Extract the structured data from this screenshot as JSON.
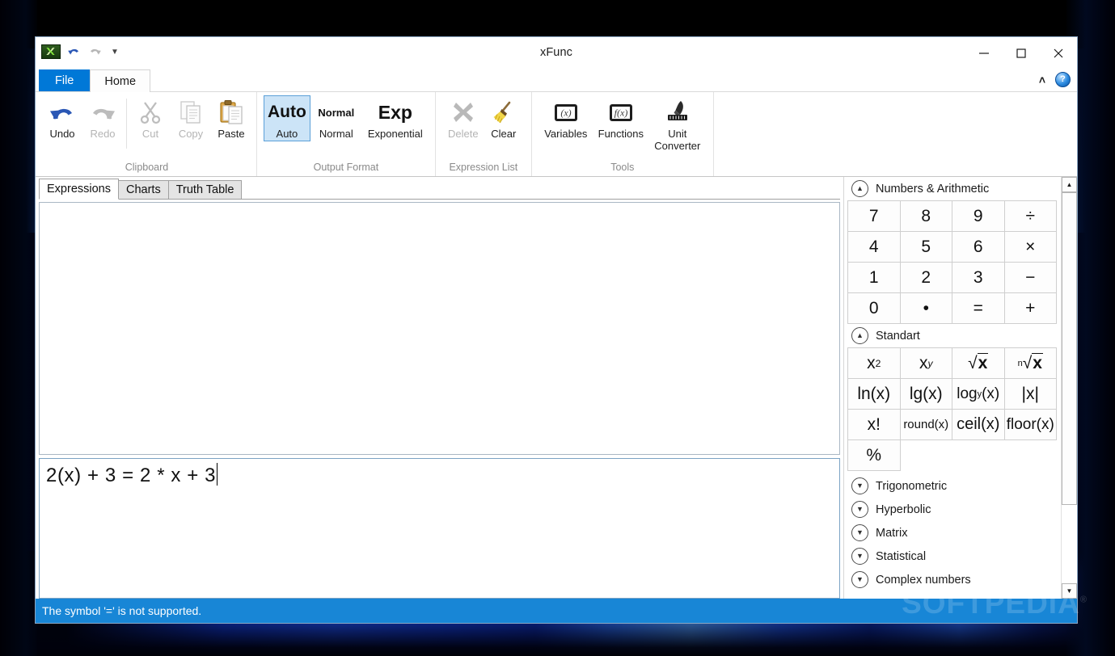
{
  "window": {
    "title": "xFunc",
    "minimize": "─",
    "maximize": "☐",
    "close": "✕"
  },
  "quick_access": {
    "app_icon": "xfunc-app-icon",
    "undo": "undo-arrow-icon",
    "redo": "redo-arrow-icon",
    "customize": "▼"
  },
  "ribbon": {
    "tabs": [
      {
        "label": "File",
        "kind": "file"
      },
      {
        "label": "Home",
        "kind": "active"
      }
    ],
    "collapse": "˄",
    "help": "?",
    "groups": [
      {
        "name": "Clipboard",
        "label": "Clipboard",
        "items": [
          {
            "label": "Undo",
            "icon": "undo-arrow-icon",
            "disabled": false
          },
          {
            "label": "Redo",
            "icon": "redo-arrow-icon",
            "disabled": true
          },
          {
            "label": "Cut",
            "icon": "scissors-icon",
            "disabled": true
          },
          {
            "label": "Copy",
            "icon": "copy-pages-icon",
            "disabled": true
          },
          {
            "label": "Paste",
            "icon": "clipboard-icon",
            "disabled": false
          }
        ]
      },
      {
        "name": "Output Format",
        "label": "Output Format",
        "items": [
          {
            "label": "Auto",
            "glyph": "Auto",
            "selected": true
          },
          {
            "label": "Normal",
            "glyph": "Normal",
            "selected": false
          },
          {
            "label": "Exponential",
            "glyph": "Exp",
            "selected": false
          }
        ]
      },
      {
        "name": "Expression List",
        "label": "Expression List",
        "items": [
          {
            "label": "Delete",
            "icon": "x-cross-icon",
            "disabled": true
          },
          {
            "label": "Clear",
            "icon": "broom-icon",
            "disabled": false
          }
        ]
      },
      {
        "name": "Tools",
        "label": "Tools",
        "items": [
          {
            "label": "Variables",
            "icon": "variables-x-icon",
            "disabled": false
          },
          {
            "label": "Functions",
            "icon": "functions-fx-icon",
            "disabled": false
          },
          {
            "label": "Unit\nConverter",
            "icon": "ruler-pencil-icon",
            "disabled": false
          }
        ]
      }
    ]
  },
  "content_tabs": [
    {
      "label": "Expressions",
      "active": true
    },
    {
      "label": "Charts",
      "active": false
    },
    {
      "label": "Truth Table",
      "active": false
    }
  ],
  "expression_input": {
    "value": "2(x) + 3 = 2 * x + 3",
    "placeholder": ""
  },
  "keypad": {
    "sections": [
      {
        "title": "Numbers & Arithmetic",
        "expanded": true,
        "icon": "chevron-up-circle-icon",
        "keys": [
          "7",
          "8",
          "9",
          "÷",
          "4",
          "5",
          "6",
          "×",
          "1",
          "2",
          "3",
          "−",
          "0",
          "•",
          "=",
          "+"
        ]
      },
      {
        "title": "Standart",
        "expanded": true,
        "icon": "chevron-up-circle-icon",
        "keys": [
          "x²",
          "xʸ",
          "√x",
          "ⁿ√x",
          "ln(x)",
          "lg(x)",
          "logᵧ(x)",
          "|x|",
          "x!",
          "round(x)",
          "ceil(x)",
          "floor(x)",
          "%",
          "",
          "",
          ""
        ]
      },
      {
        "title": "Trigonometric",
        "expanded": false,
        "icon": "chevron-down-circle-icon"
      },
      {
        "title": "Hyperbolic",
        "expanded": false,
        "icon": "chevron-down-circle-icon"
      },
      {
        "title": "Matrix",
        "expanded": false,
        "icon": "chevron-down-circle-icon"
      },
      {
        "title": "Statistical",
        "expanded": false,
        "icon": "chevron-down-circle-icon"
      },
      {
        "title": "Complex numbers",
        "expanded": false,
        "icon": "chevron-down-circle-icon"
      }
    ],
    "scroll_up": "▲",
    "scroll_down": "▼"
  },
  "status_bar": {
    "message": "The symbol '=' is not supported."
  },
  "watermark": {
    "text": "SOFTPEDIA"
  },
  "colors": {
    "accent": "#0078d7",
    "status_bar": "#1886d6",
    "selected_key": "#cce4f7",
    "ribbon_group_label": "#8a8a8a"
  }
}
